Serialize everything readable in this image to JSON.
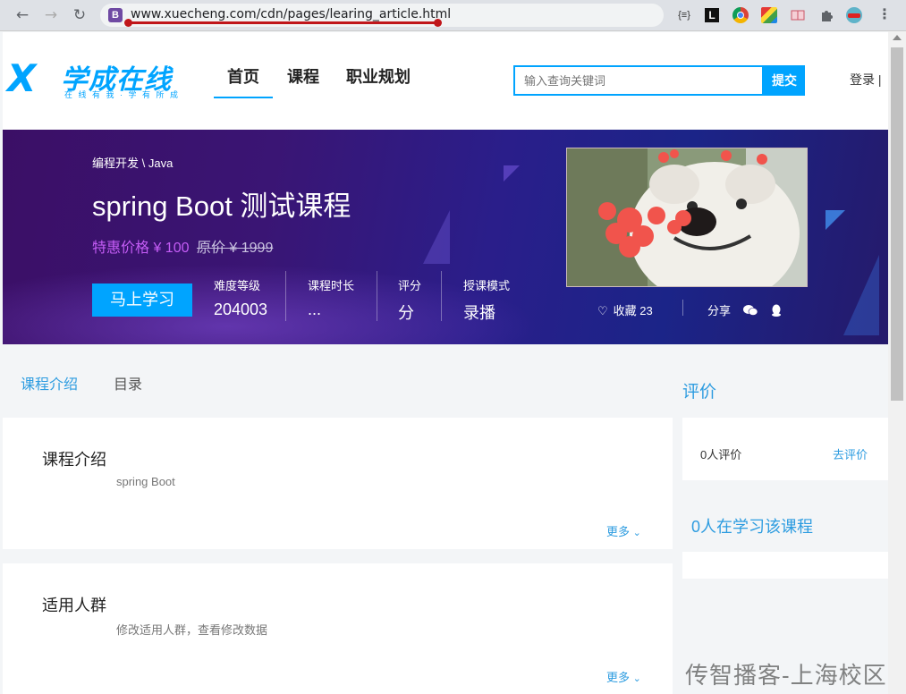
{
  "browser": {
    "url": "www.xuecheng.com/cdn/pages/learing_article.html",
    "site_icon_letter": "B",
    "back_icon": "arrow-left",
    "forward_icon": "arrow-right",
    "reload_icon": "reload",
    "extensions": [
      "json-viewer-icon",
      "ext-l-icon",
      "chrome-icon",
      "color-picker-icon",
      "reader-icon",
      "puzzle-icon",
      "avatar-icon",
      "menu-icon"
    ],
    "ext_labels": [
      "{≡}",
      "L",
      "",
      "",
      "",
      "",
      "",
      "⋮"
    ]
  },
  "header": {
    "logo_mark": "X",
    "logo_title": "学成在线",
    "logo_subtitle": "在 线 有 我 · 学 有 所 成",
    "nav": [
      "首页",
      "课程",
      "职业规划"
    ],
    "search_placeholder": "输入查询关键词",
    "search_button": "提交",
    "login": "登录 |"
  },
  "banner": {
    "breadcrumb": "编程开发 \\ Java",
    "title": "spring Boot 测试课程",
    "price_sale": "特惠价格 ¥ 100",
    "price_original": "原价 ¥ 1999",
    "learn_button": "马上学习",
    "stats": [
      {
        "label": "难度等级",
        "value": "204003"
      },
      {
        "label": "课程时长",
        "value": "..."
      },
      {
        "label": "评分",
        "value": "分"
      },
      {
        "label": "授课模式",
        "value": "录播"
      }
    ],
    "favorite": "收藏 23",
    "share": "分享",
    "colors": {
      "accent": "#00a4ff",
      "price": "#c45cf5"
    }
  },
  "tabs": [
    "课程介绍",
    "目录"
  ],
  "cards": [
    {
      "title": "课程介绍",
      "body": "spring Boot",
      "more": "更多"
    },
    {
      "title": "适用人群",
      "body": "修改适用人群，查看修改数据",
      "more": "更多"
    }
  ],
  "sidebar": {
    "review_heading": "评价",
    "review_count": "0人评价",
    "review_link": "去评价",
    "learners_heading": "0人在学习该课程"
  },
  "watermark": "传智播客-上海校区"
}
